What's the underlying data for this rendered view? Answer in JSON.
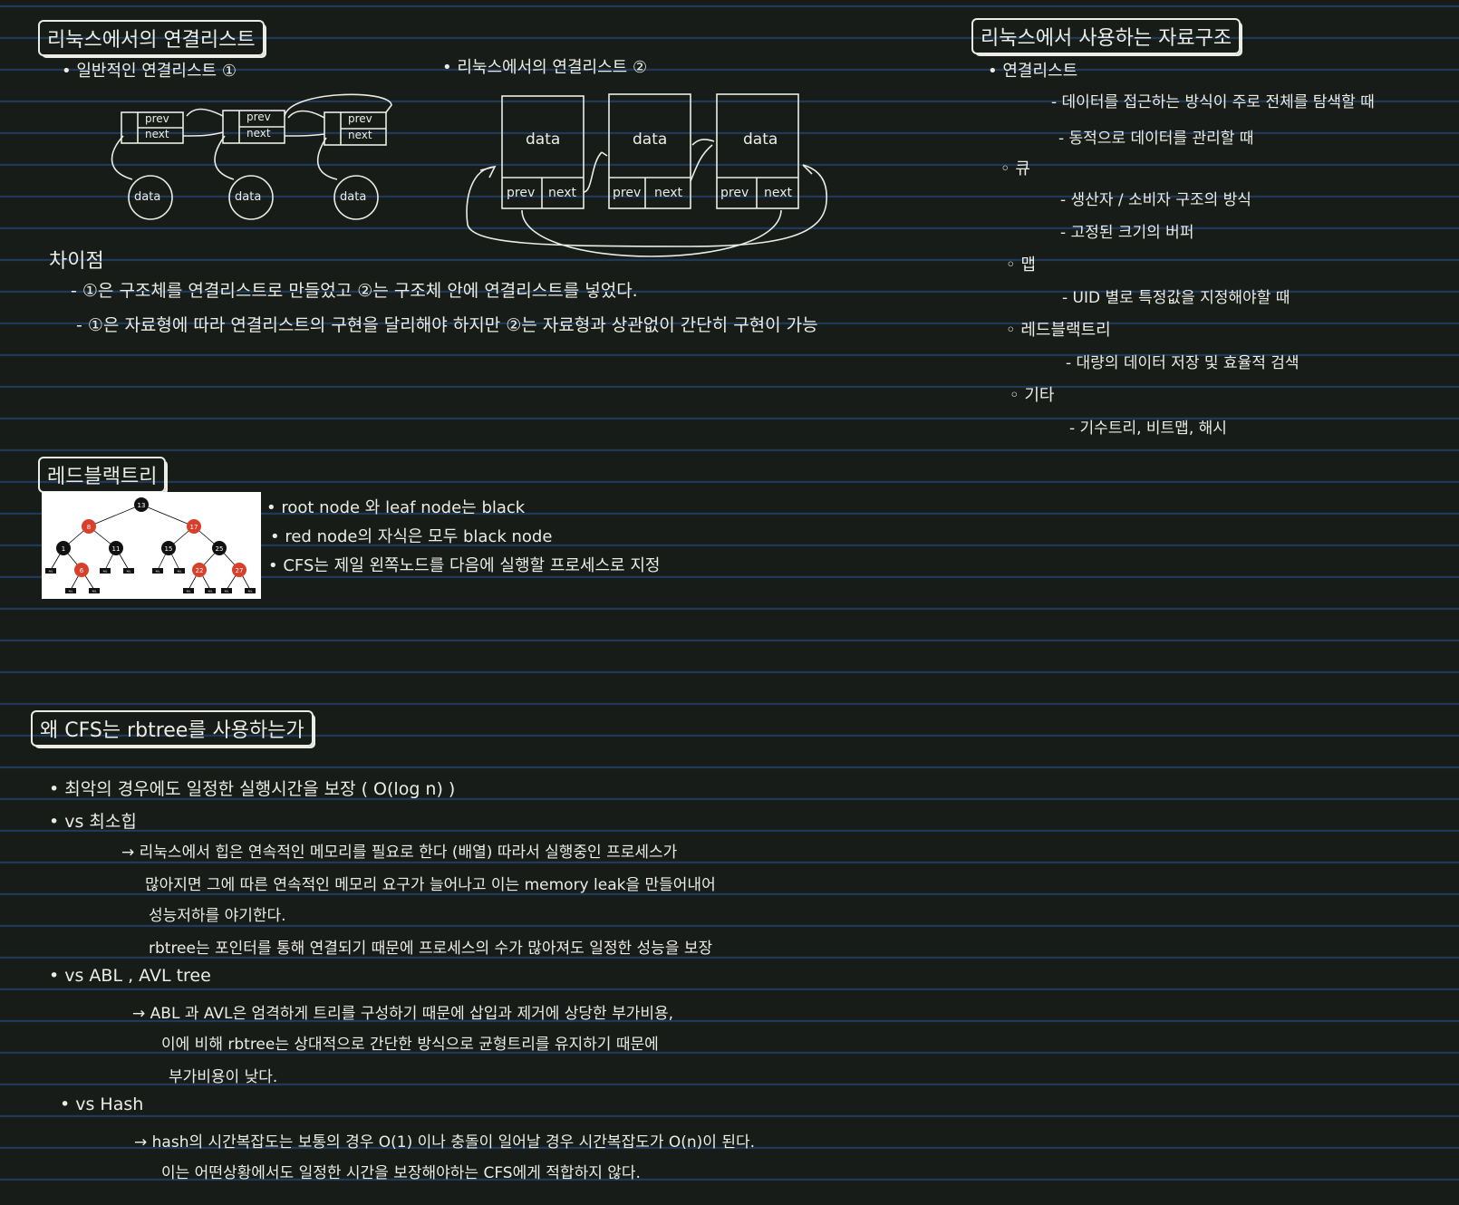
{
  "top_left": {
    "title": "리눅스에서의 연결리스트",
    "sub1": "• 일반적인 연결리스트 ①",
    "sub2": "• 리눅스에서의 연결리스트 ②",
    "node_prev": "prev",
    "node_next": "next",
    "node_data": "data",
    "diff_title": "차이점",
    "diff": [
      "- ①은 구조체를 연결리스트로 만들었고 ②는 구조체 안에 연결리스트를 넣었다.",
      "- ①은 자료형에 따라 연결리스트의 구현을 달리해야 하지만 ②는 자료형과 상관없이 간단히 구현이 가능"
    ]
  },
  "top_right": {
    "title": "리눅스에서 사용하는 자료구조",
    "items": [
      "• 연결리스트",
      "- 데이터를 접근하는 방식이 주로 전체를 탐색할 때",
      "- 동적으로 데이터를 관리할 때",
      "◦ 큐",
      "- 생산자 / 소비자 구조의 방식",
      "- 고정된 크기의 버퍼",
      "◦ 맵",
      "- UID 별로 특정값을 지정해야할 때",
      "◦ 레드블랙트리",
      "- 대량의 데이터 저장 및 효율적 검색",
      "◦ 기타",
      "- 기수트리, 비트맵, 해시"
    ]
  },
  "rb": {
    "title": "레드블랙트리",
    "notes": [
      "• root node 와 leaf node는 black",
      "• red node의 자식은 모두 black node",
      "• CFS는 제일 왼쪽노드를 다음에 실행할 프로세스로 지정"
    ],
    "tree_nodes": [
      "13",
      "8",
      "17",
      "1",
      "11",
      "15",
      "25",
      "6",
      "22",
      "27"
    ],
    "nil": "NIL"
  },
  "why": {
    "title": "왜 CFS는 rbtree를 사용하는가",
    "lines": [
      "• 최악의 경우에도 일정한 실행시간을 보장 ( O(log n) )",
      "• vs 최소힙",
      "→ 리눅스에서 힙은 연속적인 메모리를 필요로 한다 (배열) 따라서 실행중인 프로세스가",
      "많아지면 그에 따른 연속적인 메모리 요구가 늘어나고 이는 memory leak을 만들어내어",
      "성능저하를 야기한다.",
      "rbtree는 포인터를 통해 연결되기 때문에 프로세스의 수가 많아져도 일정한 성능을 보장",
      "• vs ABL , AVL tree",
      "→ ABL 과 AVL은 엄격하게 트리를 구성하기 때문에 삽입과 제거에 상당한 부가비용,",
      "이에 비해 rbtree는 상대적으로 간단한 방식으로 균형트리를 유지하기 때문에",
      "부가비용이 낮다.",
      "• vs Hash",
      "→ hash의 시간복잡도는 보통의 경우 O(1) 이나 충돌이 일어날 경우 시간복잡도가 O(n)이 된다.",
      "이는 어떤상황에서도 일정한 시간을 보장해야하는 CFS에게 적합하지 않다."
    ]
  }
}
